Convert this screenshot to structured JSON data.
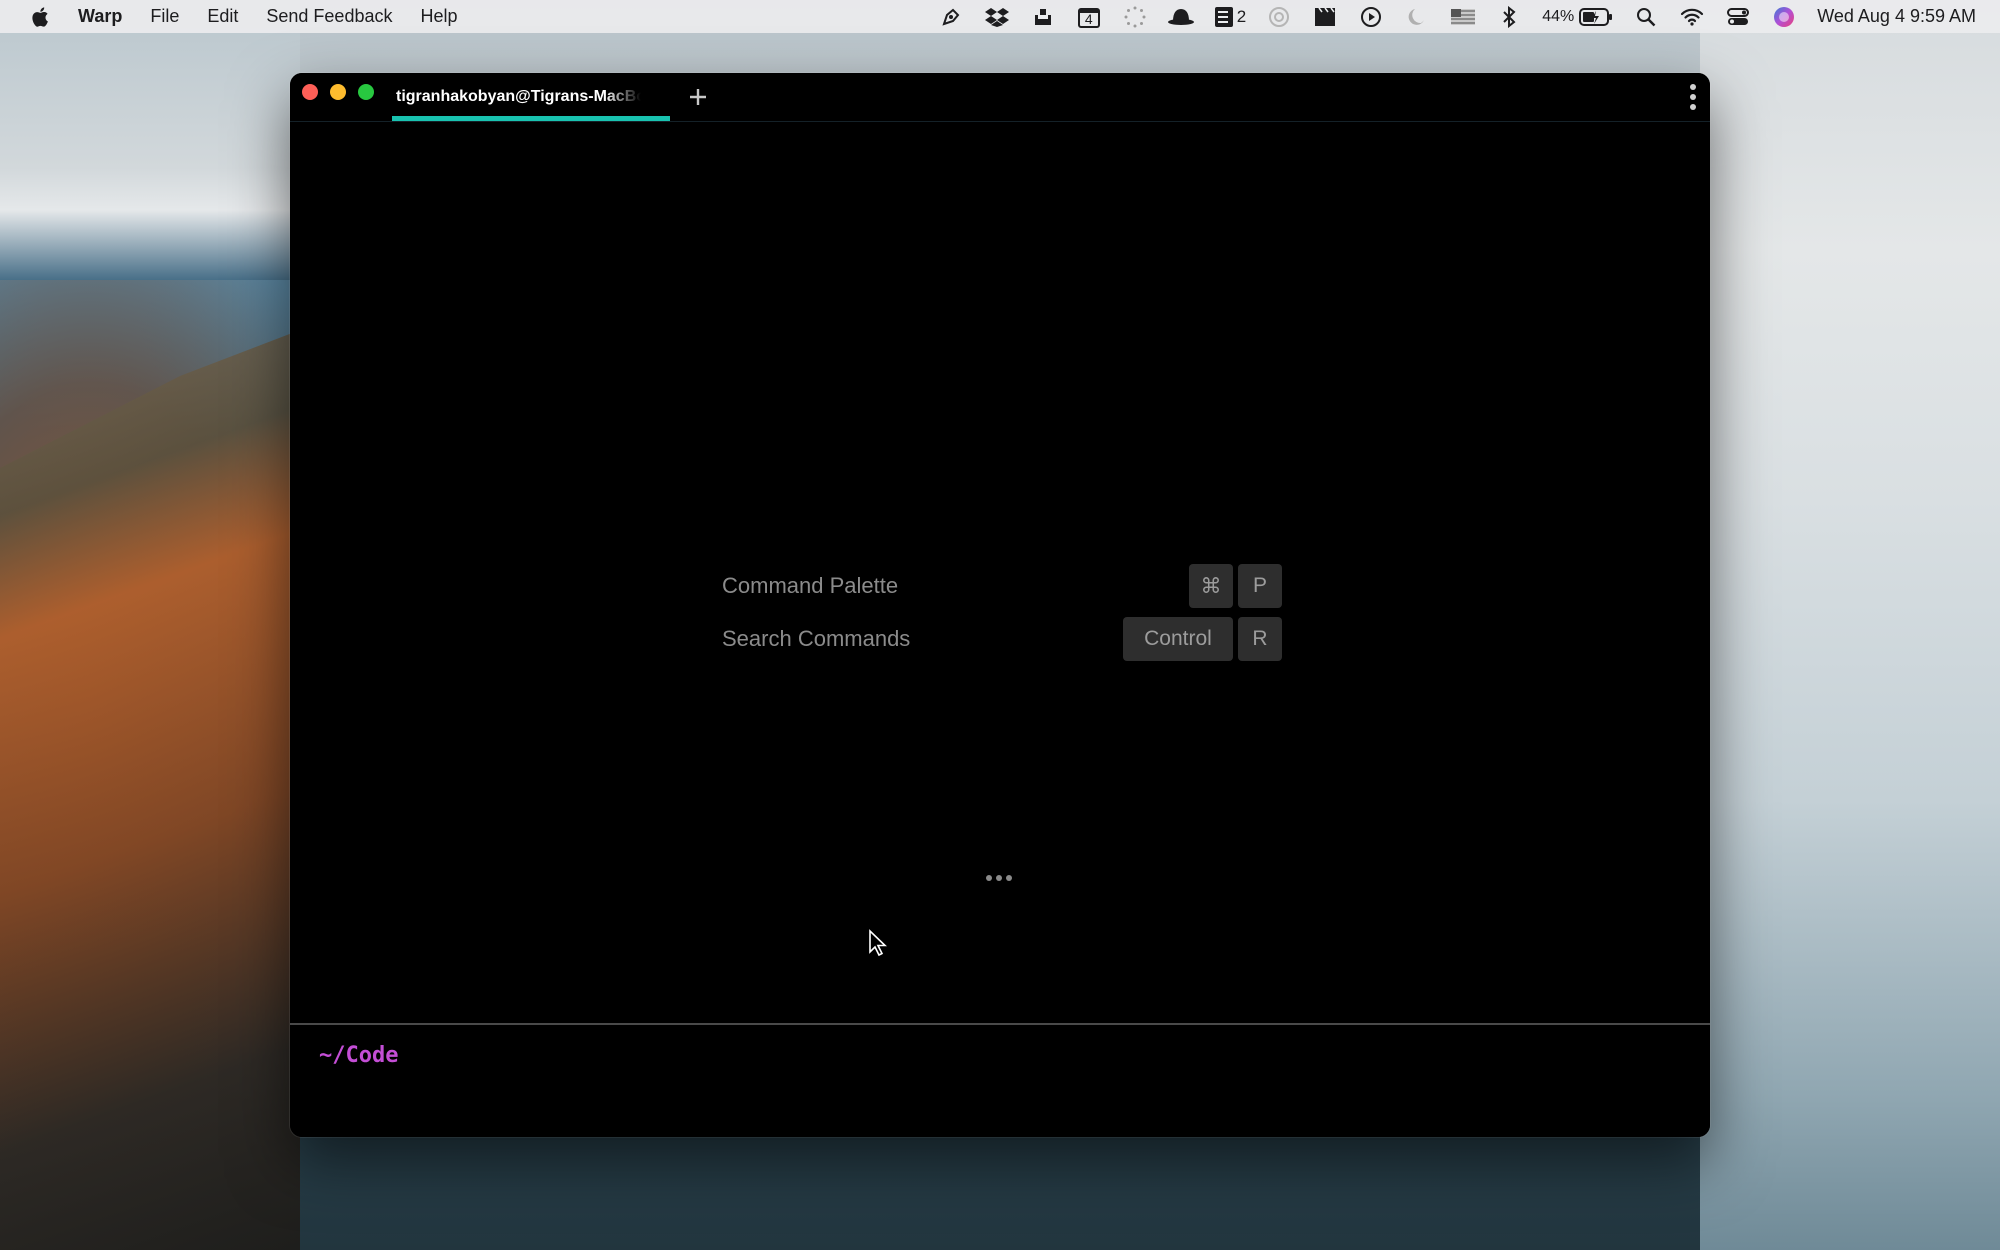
{
  "menubar": {
    "app_name": "Warp",
    "menus": [
      "File",
      "Edit",
      "Send Feedback",
      "Help"
    ],
    "tray": {
      "notification_count": "2",
      "calendar_day": "4",
      "battery_percent": "44%",
      "clock": "Wed Aug 4  9:59 AM"
    }
  },
  "window": {
    "tab_title": "tigranhakobyan@Tigrans-MacBook-Pro",
    "accent_color": "#19c3b0",
    "shortcuts": [
      {
        "label": "Command Palette",
        "keys": [
          "⌘",
          "P"
        ]
      },
      {
        "label": "Search Commands",
        "keys": [
          "Control",
          "R"
        ]
      }
    ],
    "prompt_path": "~/Code",
    "prompt_color": "#c44ed6"
  }
}
